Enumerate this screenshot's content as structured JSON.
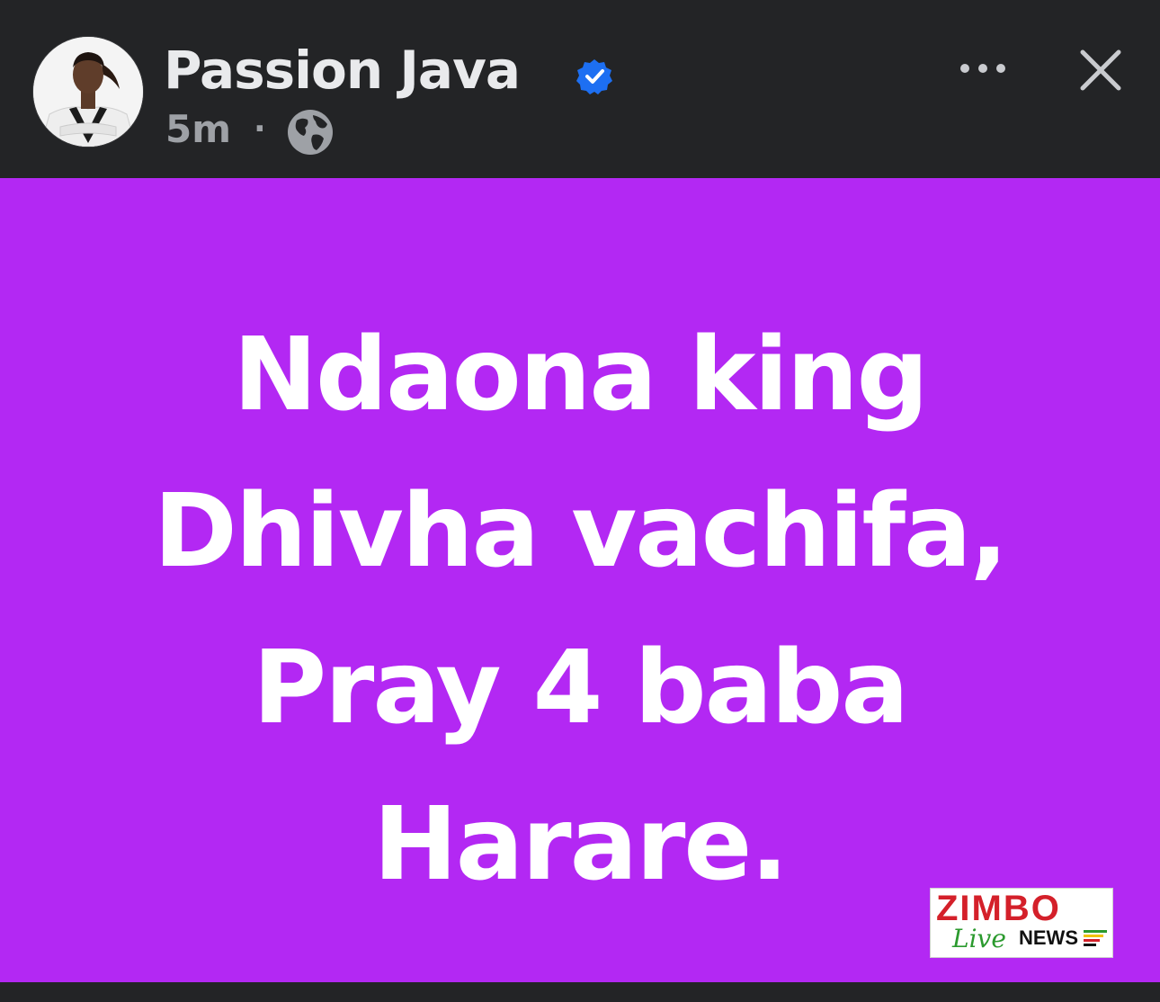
{
  "post": {
    "author": {
      "name": "Passion Java",
      "verified": true,
      "avatar_icon": "profile-photo"
    },
    "meta": {
      "time": "5m",
      "separator": "·",
      "privacy_icon": "globe-icon"
    },
    "actions": {
      "more_icon": "more-horizontal-icon",
      "close_icon": "close-icon"
    },
    "body": {
      "background_color": "#b328f3",
      "text_color": "#ffffff",
      "lines": [
        "Ndaona king",
        "Dhivha vachifa,",
        "Pray 4 baba",
        "Harare."
      ]
    },
    "watermark": {
      "brand": "ZIMBO",
      "tagline_script": "Live",
      "tagline": "NEWS"
    }
  },
  "colors": {
    "header_bg": "#232426",
    "verified_blue": "#1d6ff2",
    "muted_text": "#9ea1a6"
  }
}
